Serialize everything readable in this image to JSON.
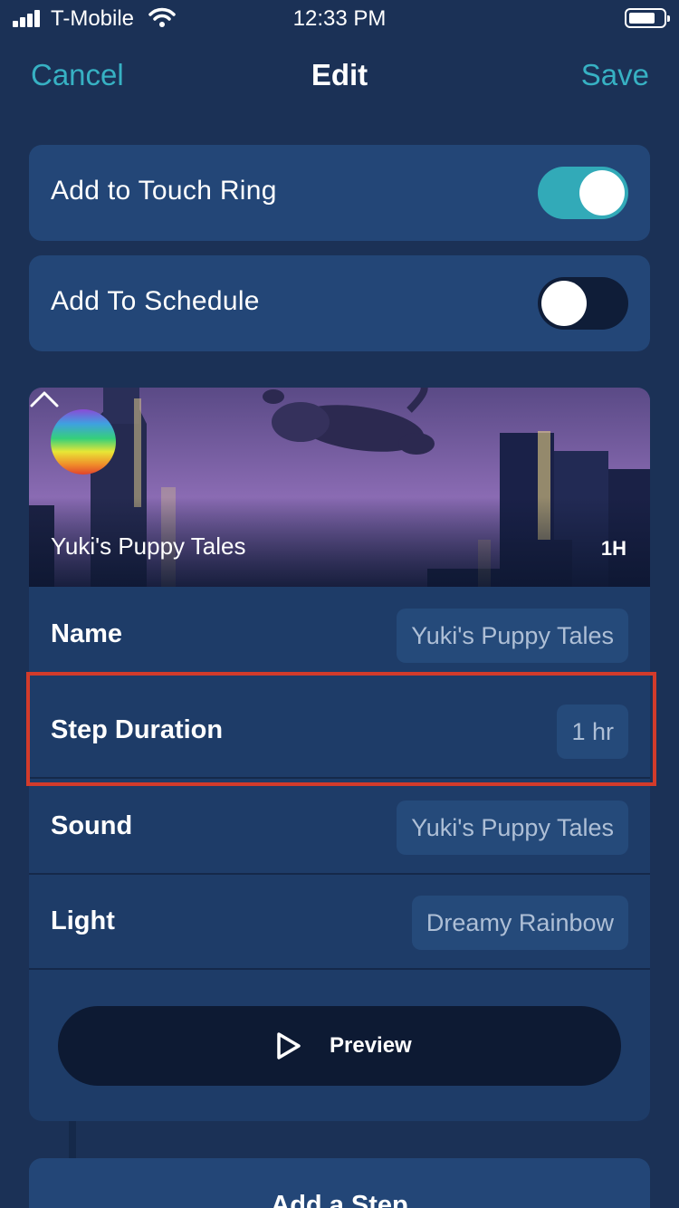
{
  "status_bar": {
    "carrier": "T-Mobile",
    "time": "12:33 PM",
    "signal_icon": "signal-bars-icon",
    "wifi_icon": "wifi-icon",
    "battery_icon": "battery-icon"
  },
  "nav": {
    "cancel_label": "Cancel",
    "title": "Edit",
    "save_label": "Save",
    "accent_color": "#37b1c3"
  },
  "toggles": [
    {
      "label": "Add to Touch Ring",
      "on": true
    },
    {
      "label": "Add To Schedule",
      "on": false
    }
  ],
  "content": {
    "title": "Yuki's Puppy Tales",
    "duration_badge": "1H",
    "collapse_icon": "chevron-up-icon",
    "light_icon": "rainbow-light-icon"
  },
  "fields": {
    "name": {
      "label": "Name",
      "value": "Yuki's Puppy Tales"
    },
    "step_duration": {
      "label": "Step Duration",
      "value": "1 hr"
    },
    "sound": {
      "label": "Sound",
      "value": "Yuki's Puppy Tales"
    },
    "light": {
      "label": "Light",
      "value": "Dreamy Rainbow"
    }
  },
  "preview": {
    "label": "Preview",
    "icon": "play-icon"
  },
  "add_step": {
    "label": "Add a Step"
  },
  "colors": {
    "background": "#1b3156",
    "card": "#234677",
    "toggle_on": "#32aab8",
    "highlight": "#d33b2b"
  }
}
